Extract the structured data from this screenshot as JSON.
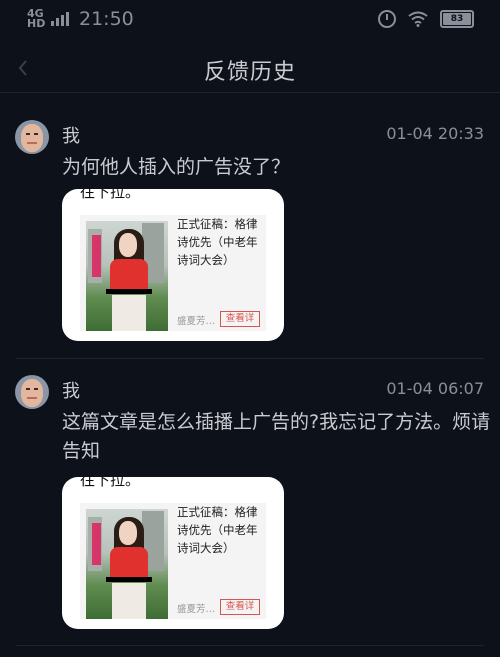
{
  "status_bar": {
    "network": "4G HD",
    "time": "21:50",
    "battery": "83"
  },
  "header": {
    "title": "反馈历史"
  },
  "feedback": [
    {
      "user": "我",
      "time": "01-04 20:33",
      "message": "为何他人插入的广告没了？",
      "thumb": {
        "cutoff_text": "往下拉。",
        "card_title": "正式征稿：格律诗优先（中老年诗词大会）",
        "card_author": "盛夏芳…",
        "card_button": "查看详"
      }
    },
    {
      "user": "我",
      "time": "01-04 06:07",
      "message": "这篇文章是怎么插播上广告的?我忘记了方法。烦请告知",
      "thumb": {
        "cutoff_text": "往下拉。",
        "card_title": "正式征稿：格律诗优先（中老年诗词大会）",
        "card_author": "盛夏芳…",
        "card_button": "查看详"
      }
    }
  ]
}
